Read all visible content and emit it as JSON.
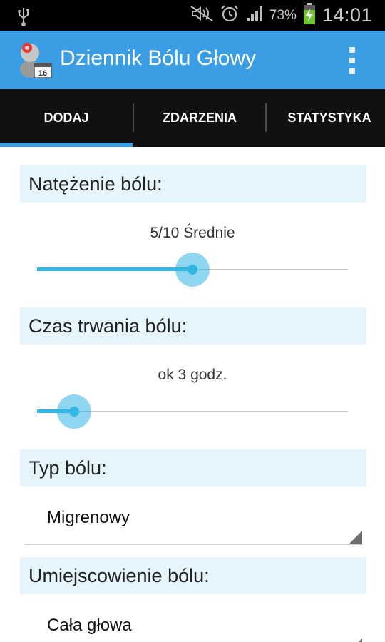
{
  "status_bar": {
    "battery_percent": "73%",
    "time": "14:01",
    "icons": [
      "usb-icon",
      "mute-icon",
      "alarm-icon",
      "signal-icon",
      "battery-charging-icon"
    ]
  },
  "app_bar": {
    "title": "Dziennik Bólu Głowy",
    "icon_badge": "16",
    "menu_icon": "overflow-menu-icon"
  },
  "tabs": [
    {
      "label": "DODAJ",
      "selected": true
    },
    {
      "label": "ZDARZENIA",
      "selected": false
    },
    {
      "label": "STATYSTYKA",
      "selected": false
    }
  ],
  "form": {
    "intensity": {
      "header": "Natężenie bólu:",
      "value_text": "5/10 Średnie",
      "value": 5,
      "max": 10
    },
    "duration": {
      "header": "Czas trwania bólu:",
      "value_text": "ok 3 godz.",
      "slider_fraction": 0.12
    },
    "pain_type": {
      "header": "Typ bólu:",
      "selected": "Migrenowy"
    },
    "location": {
      "header": "Umiejscowienie bólu:",
      "selected": "Cała głowa"
    }
  },
  "colors": {
    "accent": "#3b9ee4",
    "slider": "#33b5e5",
    "section_bg": "#e6f4fc"
  }
}
